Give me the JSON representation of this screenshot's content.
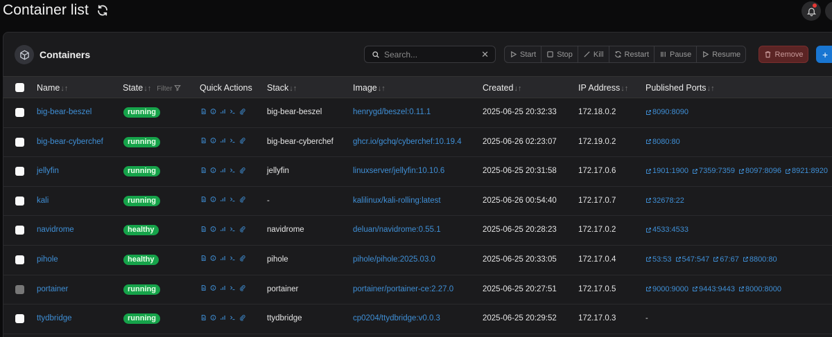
{
  "page": {
    "title": "Container list"
  },
  "panel": {
    "title": "Containers"
  },
  "search": {
    "placeholder": "Search..."
  },
  "actions": {
    "start": "Start",
    "stop": "Stop",
    "kill": "Kill",
    "restart": "Restart",
    "pause": "Pause",
    "resume": "Resume",
    "remove": "Remove",
    "add": "+"
  },
  "columns": {
    "name": "Name",
    "state": "State",
    "filter": "Filter",
    "quick_actions": "Quick Actions",
    "stack": "Stack",
    "image": "Image",
    "created": "Created",
    "ip": "IP Address",
    "ports": "Published Ports"
  },
  "rows": [
    {
      "name": "big-bear-beszel",
      "state": "running",
      "stack": "big-bear-beszel",
      "image": "henrygd/beszel:0.11.1",
      "created": "2025-06-25 20:32:33",
      "ip": "172.18.0.2",
      "ports": [
        "8090:8090"
      ]
    },
    {
      "name": "big-bear-cyberchef",
      "state": "running",
      "stack": "big-bear-cyberchef",
      "image": "ghcr.io/gchq/cyberchef:10.19.4",
      "created": "2025-06-26 02:23:07",
      "ip": "172.19.0.2",
      "ports": [
        "8080:80"
      ]
    },
    {
      "name": "jellyfin",
      "state": "running",
      "stack": "jellyfin",
      "image": "linuxserver/jellyfin:10.10.6",
      "created": "2025-06-25 20:31:58",
      "ip": "172.17.0.6",
      "ports": [
        "1901:1900",
        "7359:7359",
        "8097:8096",
        "8921:8920"
      ]
    },
    {
      "name": "kali",
      "state": "running",
      "stack": "-",
      "image": "kalilinux/kali-rolling:latest",
      "created": "2025-06-26 00:54:40",
      "ip": "172.17.0.7",
      "ports": [
        "32678:22"
      ]
    },
    {
      "name": "navidrome",
      "state": "healthy",
      "stack": "navidrome",
      "image": "deluan/navidrome:0.55.1",
      "created": "2025-06-25 20:28:23",
      "ip": "172.17.0.2",
      "ports": [
        "4533:4533"
      ]
    },
    {
      "name": "pihole",
      "state": "healthy",
      "stack": "pihole",
      "image": "pihole/pihole:2025.03.0",
      "created": "2025-06-25 20:33:05",
      "ip": "172.17.0.4",
      "ports": [
        "53:53",
        "547:547",
        "67:67",
        "8800:80"
      ]
    },
    {
      "name": "portainer",
      "state": "running",
      "stack": "portainer",
      "image": "portainer/portainer-ce:2.27.0",
      "created": "2025-06-25 20:27:51",
      "ip": "172.17.0.5",
      "ports": [
        "9000:9000",
        "9443:9443",
        "8000:8000"
      ]
    },
    {
      "name": "ttydbridge",
      "state": "running",
      "stack": "ttydbridge",
      "image": "cp0204/ttydbridge:v0.0.3",
      "created": "2025-06-25 20:29:52",
      "ip": "172.17.0.3",
      "ports": [],
      "ports_empty": "-"
    }
  ]
}
